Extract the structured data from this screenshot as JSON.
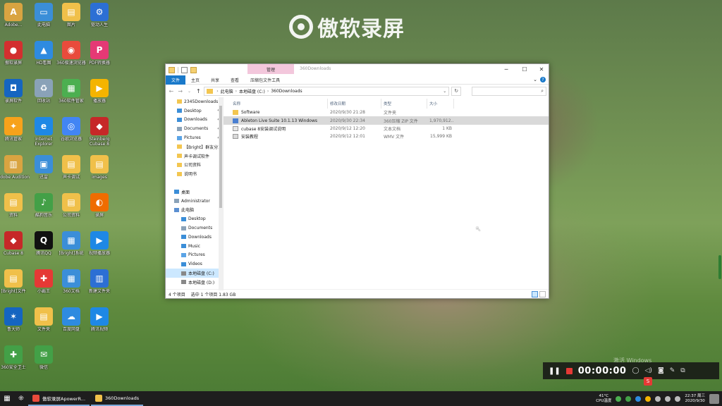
{
  "watermark": {
    "text": "傲软录屏"
  },
  "desktop_icons": [
    {
      "label": "Adobe...",
      "color": "#d9a441",
      "glyph": "A"
    },
    {
      "label": "此电脑",
      "color": "#3b8ed8",
      "glyph": "▭"
    },
    {
      "label": "图片",
      "color": "#f0c04a",
      "glyph": "▤"
    },
    {
      "label": "驱动人生",
      "color": "#2c6fd4",
      "glyph": "⚙"
    },
    {
      "label": "傲软录屏",
      "color": "#d32f2f",
      "glyph": "●"
    },
    {
      "label": "HD看图",
      "color": "#2e8be0",
      "glyph": "▲"
    },
    {
      "label": "360极速浏览器",
      "color": "#e94b3c",
      "glyph": "◉"
    },
    {
      "label": "PDF转换器",
      "color": "#e53975",
      "glyph": "P"
    },
    {
      "label": "录屏软件",
      "color": "#1565c0",
      "glyph": "◘"
    },
    {
      "label": "回收站",
      "color": "#8aa2b8",
      "glyph": "♻"
    },
    {
      "label": "360软件管家",
      "color": "#4caf50",
      "glyph": "▦"
    },
    {
      "label": "播放器",
      "color": "#f4b400",
      "glyph": "▶"
    },
    {
      "label": "腾讯管家",
      "color": "#f7a21b",
      "glyph": "✦"
    },
    {
      "label": "Internet Explorer",
      "color": "#1e88e5",
      "glyph": "e"
    },
    {
      "label": "谷歌浏览器",
      "color": "#4285f4",
      "glyph": "◎"
    },
    {
      "label": "Steinberg Cubase 8",
      "color": "#c62828",
      "glyph": "◆"
    },
    {
      "label": "Adobe Audition",
      "color": "#d9a441",
      "glyph": "▥"
    },
    {
      "label": "迅雷",
      "color": "#3b8ed8",
      "glyph": "▣"
    },
    {
      "label": "声卡调试",
      "color": "#f0c04a",
      "glyph": "▤"
    },
    {
      "label": "images",
      "color": "#f0c04a",
      "glyph": "▤"
    },
    {
      "label": "资料",
      "color": "#f0c04a",
      "glyph": "▤"
    },
    {
      "label": "酷狗音乐",
      "color": "#43a047",
      "glyph": "♪"
    },
    {
      "label": "公司资料",
      "color": "#f0c04a",
      "glyph": "▤"
    },
    {
      "label": "录屏",
      "color": "#ef6c00",
      "glyph": "◐"
    },
    {
      "label": "Cubase 8",
      "color": "#c62828",
      "glyph": "◆"
    },
    {
      "label": "腾讯QQ",
      "color": "#111111",
      "glyph": "Q"
    },
    {
      "label": "[Bright]系统",
      "color": "#3b8ed8",
      "glyph": "▦"
    },
    {
      "label": "视频播放器",
      "color": "#1e88e5",
      "glyph": "▶"
    },
    {
      "label": "[Bright]文件",
      "color": "#f0c04a",
      "glyph": "▤"
    },
    {
      "label": "小霸王",
      "color": "#e53935",
      "glyph": "✚"
    },
    {
      "label": "360文档",
      "color": "#3b8ed8",
      "glyph": "▦"
    },
    {
      "label": "新建文件夹",
      "color": "#2c6fd4",
      "glyph": "▥"
    },
    {
      "label": "鲁大师",
      "color": "#1565c0",
      "glyph": "✶"
    },
    {
      "label": "文件夹",
      "color": "#f0c04a",
      "glyph": "▤"
    },
    {
      "label": "百度网盘",
      "color": "#2e8be0",
      "glyph": "☁"
    },
    {
      "label": "腾讯视频",
      "color": "#1e88e5",
      "glyph": "▶"
    },
    {
      "label": "360安全卫士",
      "color": "#43a047",
      "glyph": "✚"
    },
    {
      "label": "微信",
      "color": "#43a047",
      "glyph": "✉"
    }
  ],
  "explorer": {
    "manage_tab": "管理",
    "title": "360Downloads",
    "controls": {
      "minimize": "─",
      "maximize": "☐",
      "close": "✕"
    },
    "ribbon_tabs": [
      "文件",
      "主页",
      "共享",
      "查看",
      "压缩包文件工具"
    ],
    "address": {
      "crumbs": [
        "此电脑",
        "本地磁盘 (C:)",
        "360Downloads"
      ],
      "placeholder": ""
    },
    "nav_items": [
      {
        "label": "2345Downloads",
        "type": "folder",
        "pin": false,
        "sel": false
      },
      {
        "label": "Desktop",
        "type": "blue",
        "pin": true,
        "sel": false
      },
      {
        "label": "Downloads",
        "type": "down",
        "pin": true,
        "sel": false
      },
      {
        "label": "Documents",
        "type": "doc",
        "pin": true,
        "sel": false
      },
      {
        "label": "Pictures",
        "type": "pic",
        "pin": true,
        "sel": false
      },
      {
        "label": "【Bright】群友分享",
        "type": "folder",
        "pin": false,
        "sel": false
      },
      {
        "label": "声卡调试软件",
        "type": "folder",
        "pin": false,
        "sel": false
      },
      {
        "label": "公司资料",
        "type": "folder",
        "pin": false,
        "sel": false
      },
      {
        "label": "说明书",
        "type": "folder",
        "pin": false,
        "sel": false
      },
      {
        "label": "",
        "type": "none",
        "pin": false,
        "sel": false
      },
      {
        "label": "桌面",
        "type": "blue",
        "pin": false,
        "sel": false
      },
      {
        "label": "Administrator",
        "type": "user",
        "pin": false,
        "sel": false
      },
      {
        "label": "此电脑",
        "type": "pc",
        "pin": false,
        "sel": false
      },
      {
        "label": "Desktop",
        "type": "blue",
        "pin": false,
        "sel": false
      },
      {
        "label": "Documents",
        "type": "doc",
        "pin": false,
        "sel": false
      },
      {
        "label": "Downloads",
        "type": "down",
        "pin": false,
        "sel": false
      },
      {
        "label": "Music",
        "type": "music",
        "pin": false,
        "sel": false
      },
      {
        "label": "Pictures",
        "type": "pic",
        "pin": false,
        "sel": false
      },
      {
        "label": "Videos",
        "type": "video",
        "pin": false,
        "sel": false
      },
      {
        "label": "本地磁盘 (C:)",
        "type": "drive",
        "pin": false,
        "sel": true
      },
      {
        "label": "本地磁盘 (D:)",
        "type": "drive",
        "pin": false,
        "sel": false
      }
    ],
    "columns": [
      "名称",
      "修改日期",
      "类型",
      "大小"
    ],
    "files": [
      {
        "name": "Software",
        "date": "2020/9/30 21:28",
        "type": "文件夹",
        "size": "",
        "icon": "folder",
        "sel": false
      },
      {
        "name": "Ableton Live Suite 10.1.13 Windows",
        "date": "2020/9/30 22:34",
        "type": "360压缩 ZIP 文件",
        "size": "1,970,912...",
        "icon": "zip",
        "sel": true
      },
      {
        "name": "cubase 8安装调试说明",
        "date": "2020/9/12 12:20",
        "type": "文本文档",
        "size": "1 KB",
        "icon": "txt",
        "sel": false
      },
      {
        "name": "安装教程",
        "date": "2020/9/12 12:01",
        "type": "WMV 文件",
        "size": "15,999 KB",
        "icon": "wmv",
        "sel": false
      }
    ],
    "status": {
      "count": "4 个项目",
      "selected": "选中 1 个项目  1.83 GB"
    }
  },
  "recorder": {
    "time": "00:00:00"
  },
  "activate_hint": "激活 Windows",
  "taskbar": {
    "apps": [
      {
        "label": "傲软录屏ApowerR...",
        "color": "#e94b3c"
      },
      {
        "label": "360Downloads",
        "color": "#f0c04a"
      }
    ],
    "weather": {
      "temp": "41°C",
      "label": "CPU温度"
    },
    "clock": {
      "time": "22:37 周三",
      "date": "2020/9/30"
    }
  }
}
